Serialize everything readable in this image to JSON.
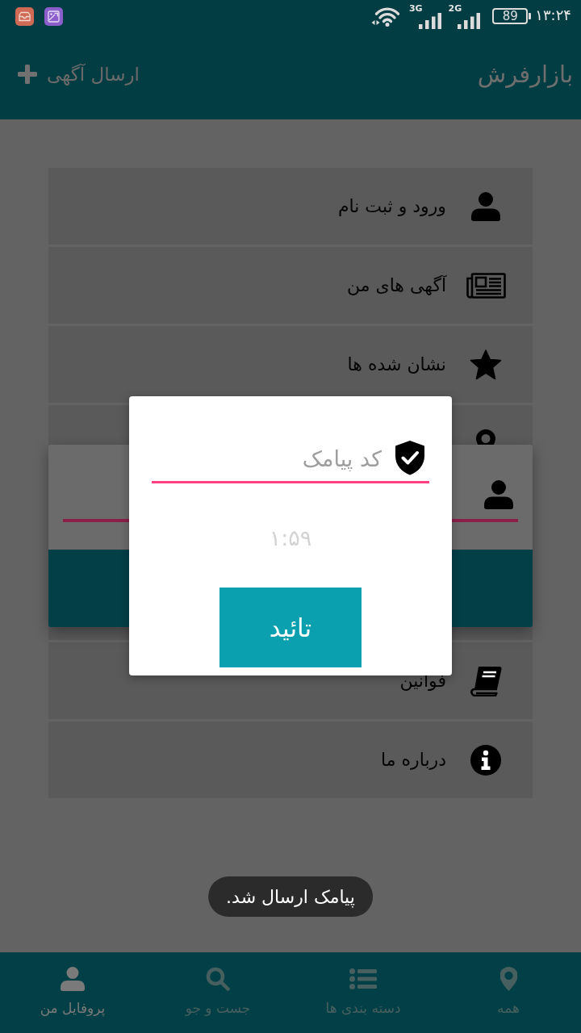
{
  "status_bar": {
    "time": "۱۳:۲۴",
    "battery": "89",
    "signals": [
      {
        "label": "2G"
      },
      {
        "label": "3G"
      }
    ]
  },
  "app_bar": {
    "title": "بازارفرش",
    "post_button": "ارسال آگهی"
  },
  "menu": {
    "items_above_card": [
      {
        "label": "ورود و ثبت نام"
      },
      {
        "label": "آگهی های من"
      },
      {
        "label": "نشان شده ها"
      }
    ],
    "items_below_card": [
      {
        "label": "فوانین"
      },
      {
        "label": "درباره ما"
      }
    ]
  },
  "login_card": {
    "field": {
      "focused": true
    }
  },
  "sms_dialog": {
    "code_field": {
      "placeholder": "کد پیامک",
      "focused": true
    },
    "timer": "۱:۵۹",
    "confirm_button": "تائید"
  },
  "toast": "پیامک ارسال شد.",
  "bottom_nav": [
    {
      "label": "همه",
      "selected": false
    },
    {
      "label": "دسته بندی ها",
      "selected": false
    },
    {
      "label": "جست و جو",
      "selected": false
    },
    {
      "label": "پروفایل من",
      "selected": true
    }
  ]
}
